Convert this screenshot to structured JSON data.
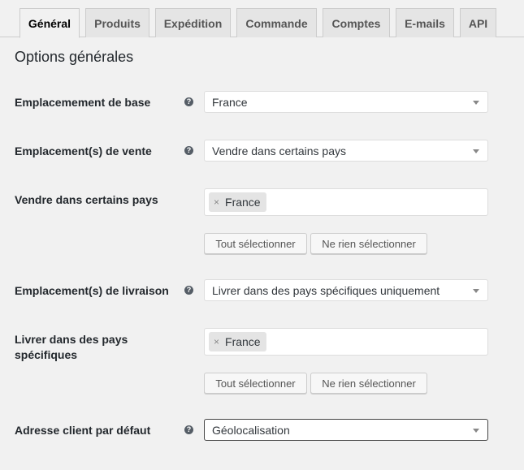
{
  "tabs": [
    {
      "label": "Général",
      "active": true
    },
    {
      "label": "Produits"
    },
    {
      "label": "Expédition"
    },
    {
      "label": "Commande"
    },
    {
      "label": "Comptes"
    },
    {
      "label": "E-mails"
    },
    {
      "label": "API"
    }
  ],
  "section_title": "Options générales",
  "help_glyph": "?",
  "rows": {
    "base_location": {
      "label": "Emplacemement de base",
      "value": "France"
    },
    "selling_location": {
      "label": "Emplacement(s) de vente",
      "value": "Vendre dans certains pays"
    },
    "specific_countries": {
      "label": "Vendre dans certains pays",
      "chips": [
        {
          "label": "France"
        }
      ]
    },
    "shipping_location": {
      "label": "Emplacement(s) de livraison",
      "value": "Livrer dans des pays spécifiques uniquement"
    },
    "ship_specific_countries": {
      "label_line1": "Livrer dans des pays",
      "label_line2": "spécifiques",
      "chips": [
        {
          "label": "France"
        }
      ]
    },
    "default_customer_address": {
      "label": "Adresse client par défaut",
      "value": "Géolocalisation"
    }
  },
  "buttons": {
    "select_all": "Tout sélectionner",
    "select_none": "Ne rien sélectionner"
  },
  "chip_remove_glyph": "×",
  "colors": {
    "background": "#f1f1f1",
    "help_icon": "#555d66",
    "tab_inactive": "#e5e5e5"
  }
}
